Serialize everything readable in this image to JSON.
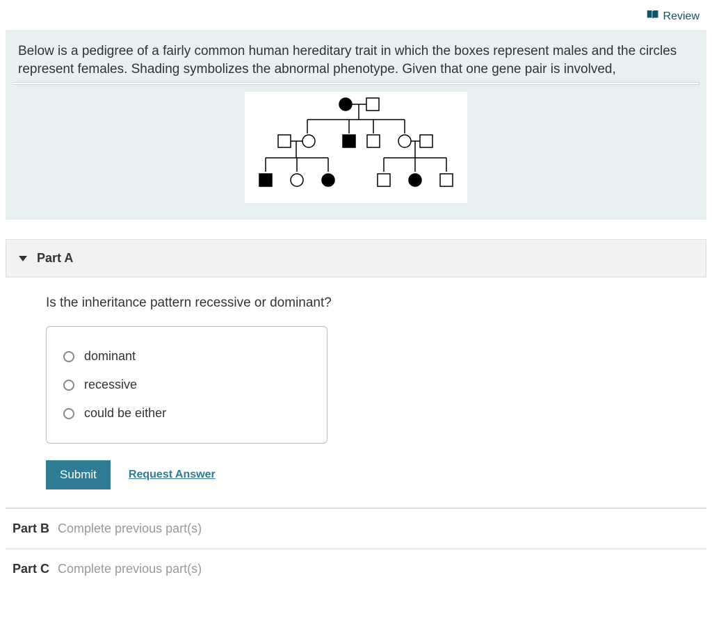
{
  "header": {
    "review_label": "Review"
  },
  "problem": {
    "text": "Below is a pedigree of a fairly common human hereditary trait in which the boxes represent males and the circles represent females. Shading symbolizes the abnormal phenotype. Given that one gene pair is involved,"
  },
  "partA": {
    "label": "Part A",
    "question": "Is the inheritance pattern recessive or dominant?",
    "options": [
      "dominant",
      "recessive",
      "could be either"
    ],
    "submit_label": "Submit",
    "request_label": "Request Answer"
  },
  "partB": {
    "label": "Part B",
    "message": "Complete previous part(s)"
  },
  "partC": {
    "label": "Part C",
    "message": "Complete previous part(s)"
  }
}
